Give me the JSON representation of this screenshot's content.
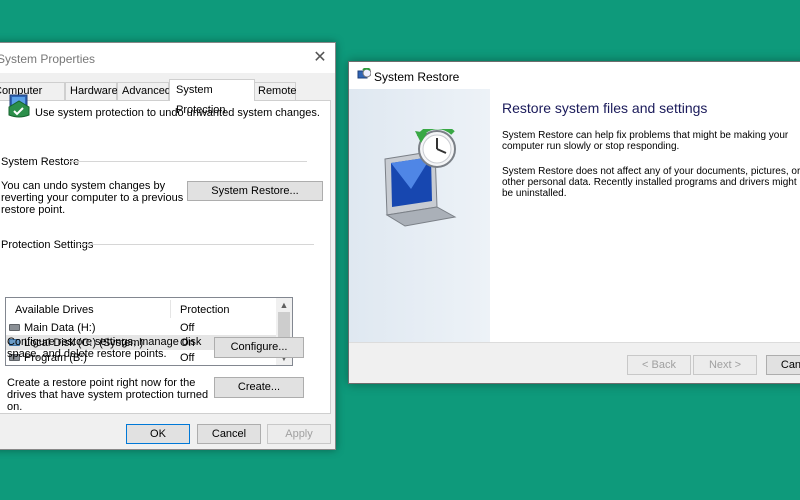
{
  "system_properties": {
    "title": "System Properties",
    "close_glyph": "✕",
    "tabs": [
      {
        "label": "Computer Name"
      },
      {
        "label": "Hardware"
      },
      {
        "label": "Advanced"
      },
      {
        "label": "System Protection"
      },
      {
        "label": "Remote"
      }
    ],
    "intro": "Use system protection to undo unwanted system changes.",
    "restore_group": {
      "title": "System Restore",
      "description": "You can undo system changes by reverting your computer to a previous restore point.",
      "button": "System Restore..."
    },
    "protection_group": {
      "title": "Protection Settings",
      "columns": [
        "Available Drives",
        "Protection"
      ],
      "drives": [
        {
          "name": "Main Data (H:)",
          "protection": "Off",
          "icon": "drive-icon"
        },
        {
          "name": "Local Disk (C:) (System)",
          "protection": "On",
          "icon": "system-drive-icon"
        },
        {
          "name": "Program (B:)",
          "protection": "Off",
          "icon": "drive-icon"
        }
      ]
    },
    "configure": {
      "description": "Configure restore settings, manage disk space, and delete restore points.",
      "button": "Configure..."
    },
    "create": {
      "description": "Create a restore point right now for the drives that have system protection turned on.",
      "button": "Create..."
    },
    "footer": {
      "ok": "OK",
      "cancel": "Cancel",
      "apply": "Apply"
    }
  },
  "system_restore": {
    "title": "System Restore",
    "heading": "Restore system files and settings",
    "para1": "System Restore can help fix problems that might be making your computer run slowly or stop responding.",
    "para2": "System Restore does not affect any of your documents, pictures, or other personal data. Recently installed programs and drivers might be uninstalled.",
    "footer": {
      "back": "< Back",
      "next": "Next >",
      "cancel": "Cancel"
    }
  },
  "colors": {
    "desktop": "#0e9a7b",
    "accent": "#0078d7"
  }
}
